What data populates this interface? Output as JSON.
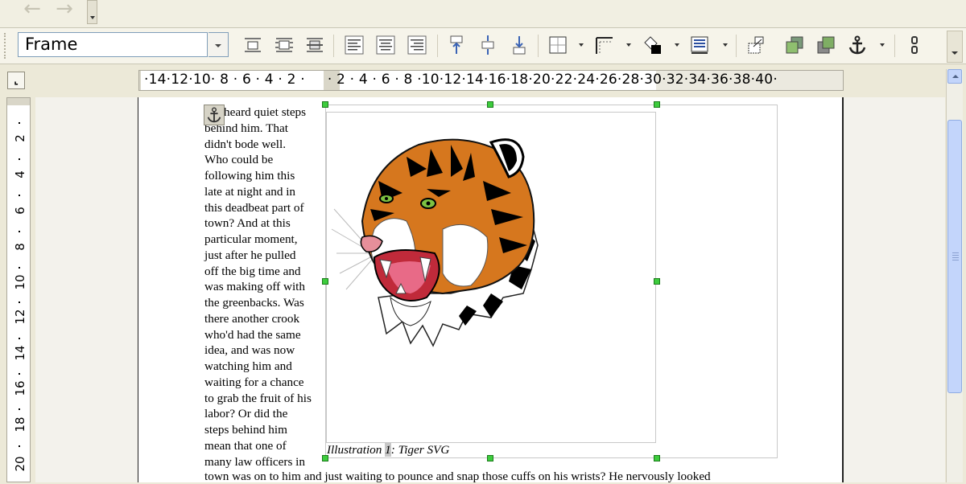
{
  "navbar": {
    "back_icon": "arrow-left-icon",
    "forward_icon": "arrow-right-icon"
  },
  "toolbar": {
    "style_value": "Frame",
    "icons": [
      "wrap-off-icon",
      "page-wrap-icon",
      "wrap-through-icon",
      "align-left-icon",
      "align-center-icon",
      "align-right-icon",
      "align-top-icon",
      "align-middle-icon",
      "align-bottom-icon",
      "borders-icon",
      "border-style-icon",
      "background-color-icon",
      "frame-properties-icon",
      "link-frames-icon",
      "bring-forward-icon",
      "send-backward-icon",
      "anchor-icon",
      "unlink-frames-icon"
    ]
  },
  "ruler": {
    "horizontal": "·14·12·10· 8 · 6 · 4 · 2 ·     · 2 · 4 · 6 · 8 ·10·12·14·16·18·20·22·24·26·28·30·32·34·36·38·40·",
    "vertical": [
      "2",
      "4",
      "6",
      "8",
      "10",
      "12",
      "14",
      "16",
      "18",
      "20"
    ]
  },
  "document": {
    "lines": [
      "heard quiet steps",
      "behind him. That",
      "didn't bode well.",
      "Who could be",
      "following him this",
      "late at night and in",
      "this deadbeat part of",
      "town? And at this",
      "particular moment,",
      "just after he pulled",
      "off the big time and",
      "was making off with",
      "the greenbacks. Was",
      "there another crook",
      "who'd had the same",
      "idea, and was now",
      "watching him and",
      "waiting for a chance",
      "to grab the fruit of his",
      "labor? Or did the",
      "steps behind him",
      "mean that one of",
      "many law officers in"
    ],
    "bottom_line": "town was on to him and just waiting to pounce and snap those cuffs on his wrists? He nervously looked",
    "caption_prefix": "Illustration ",
    "caption_number": "1",
    "caption_suffix": ": Tiger SVG",
    "image_name": "tiger-illustration"
  },
  "colors": {
    "selection_handle": "#3dcc3d",
    "scroll_accent": "#c3d5fb"
  }
}
